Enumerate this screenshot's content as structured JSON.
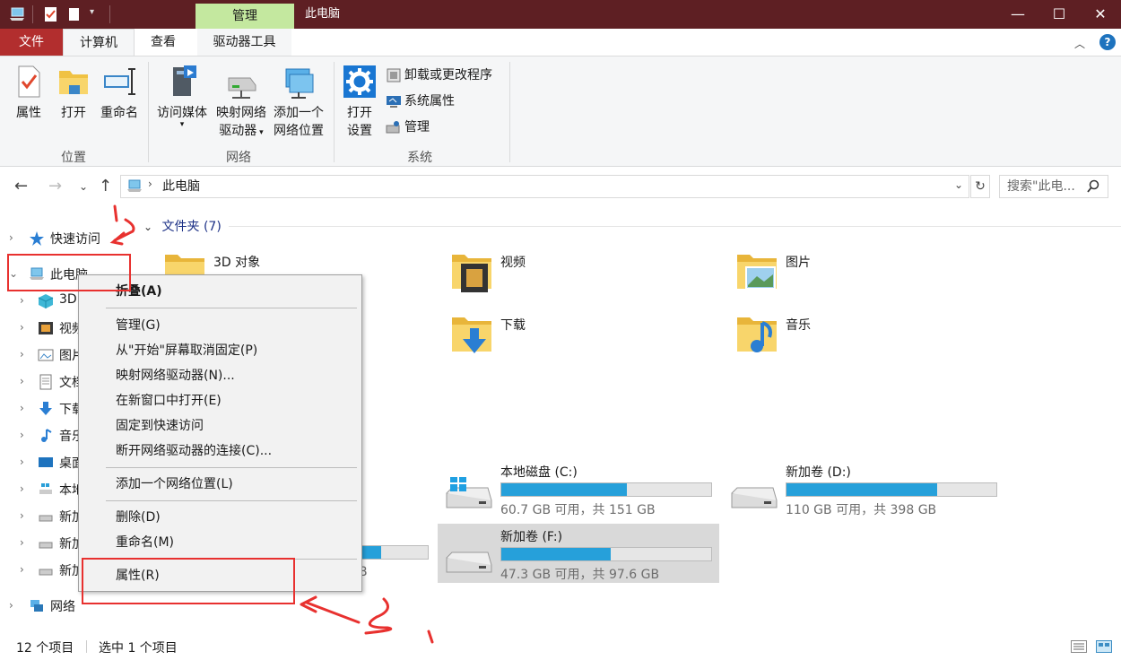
{
  "titlebar": {
    "context_tab": "管理",
    "title": "此电脑",
    "minimize": "—",
    "maximize": "☐",
    "close": "✕"
  },
  "tabs": {
    "file": "文件",
    "computer": "计算机",
    "view": "查看",
    "drive_tools": "驱动器工具"
  },
  "ribbon": {
    "location": {
      "label": "位置",
      "properties": "属性",
      "open": "打开",
      "rename": "重命名"
    },
    "network": {
      "label": "网络",
      "access_media_line1": "访问媒体",
      "map_drive_line1": "映射网络",
      "map_drive_line2": "驱动器",
      "add_location_line1": "添加一个",
      "add_location_line2": "网络位置"
    },
    "system": {
      "label": "系统",
      "open_settings_line1": "打开",
      "open_settings_line2": "设置",
      "uninstall": "卸载或更改程序",
      "system_props": "系统属性",
      "manage": "管理"
    }
  },
  "address": {
    "path": "此电脑",
    "search_placeholder": "搜索\"此电..."
  },
  "nav": {
    "items": [
      {
        "label": "快速访问"
      },
      {
        "label": "此电脑"
      },
      {
        "label": "3D"
      },
      {
        "label": "视频"
      },
      {
        "label": "图片"
      },
      {
        "label": "文档"
      },
      {
        "label": "下载"
      },
      {
        "label": "音乐"
      },
      {
        "label": "桌面"
      },
      {
        "label": "本地"
      },
      {
        "label": "新加"
      },
      {
        "label": "新加"
      },
      {
        "label": "新加"
      },
      {
        "label": "网络"
      }
    ]
  },
  "content": {
    "folders_header": "文件夹 (7)",
    "folders": [
      {
        "label": "3D 对象"
      },
      {
        "label": "视频"
      },
      {
        "label": "图片"
      },
      {
        "label": "下载"
      },
      {
        "label": "音乐"
      }
    ],
    "drives": [
      {
        "label": "本地磁盘 (C:)",
        "info": "60.7 GB 可用，共 151 GB",
        "used_fraction": 0.6
      },
      {
        "label": "新加卷 (D:)",
        "info": "110 GB 可用，共 398 GB",
        "used_fraction": 0.72
      },
      {
        "label": "新加卷 (F:)",
        "info": "47.3 GB 可用，共 97.6 GB",
        "used_fraction": 0.52
      }
    ],
    "partial_drive_fragment": "B"
  },
  "context_menu": {
    "items": [
      {
        "label": "折叠(A)"
      },
      {
        "label": "管理(G)"
      },
      {
        "label": "从\"开始\"屏幕取消固定(P)"
      },
      {
        "label": "映射网络驱动器(N)..."
      },
      {
        "label": "在新窗口中打开(E)"
      },
      {
        "label": "固定到快速访问"
      },
      {
        "label": "断开网络驱动器的连接(C)..."
      },
      {
        "label": "添加一个网络位置(L)"
      },
      {
        "label": "删除(D)"
      },
      {
        "label": "重命名(M)"
      },
      {
        "label": "属性(R)"
      }
    ]
  },
  "status": {
    "count": "12 个项目",
    "selected": "选中 1 个项目"
  },
  "colors": {
    "titlebar": "#5e1f23",
    "file_tab": "#b22e2e",
    "context_tab": "#c4e89f",
    "drive_bar": "#26a0da",
    "annotation": "#e8312f"
  }
}
